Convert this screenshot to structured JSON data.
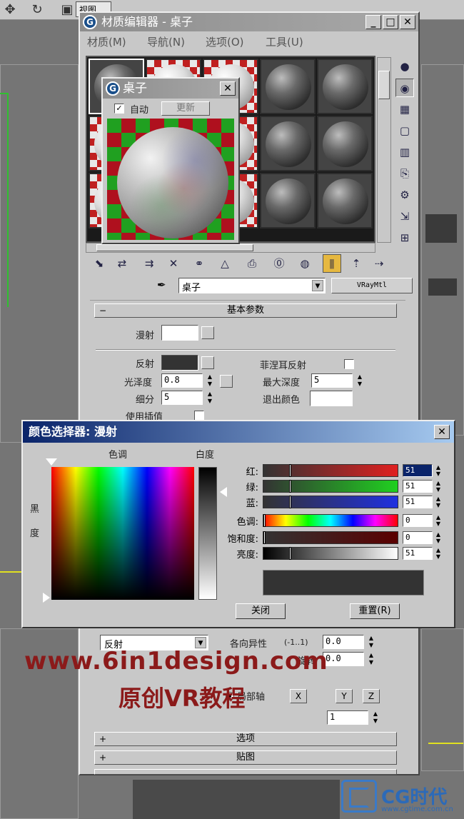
{
  "viewport": {
    "view_label": "视图"
  },
  "material_editor": {
    "title": "材质编辑器 - 桌子",
    "menu": [
      "材质(M)",
      "导航(N)",
      "选项(O)",
      "工具(U)"
    ],
    "material_name": "桌子",
    "material_type": "VRayMtl",
    "rollouts": {
      "basic_params": "基本参数",
      "options": "选项",
      "maps": "贴图"
    },
    "params": {
      "diffuse_label": "漫射",
      "reflect_label": "反射",
      "fresnel_label": "菲涅耳反射",
      "gloss_label": "光泽度",
      "gloss_value": "0.8",
      "max_depth_label": "最大深度",
      "max_depth_value": "5",
      "subdiv_label": "细分",
      "subdiv_value": "5",
      "exit_color_label": "退出颜色",
      "interp_label": "使用插值"
    },
    "lower": {
      "brdf_type": "反射",
      "aniso_label": "各向异性",
      "aniso_range": "(-1..1)",
      "aniso_value": "0.0",
      "rotation_label": "旋转",
      "rotation_value": "0.0",
      "local_axis_label": "局部轴",
      "axis_x": "X",
      "axis_y": "Y",
      "axis_z": "Z",
      "map_channel_value": "1"
    }
  },
  "preview": {
    "title": "桌子",
    "auto_label": "自动",
    "update_label": "更新"
  },
  "color_selector": {
    "title": "颜色选择器: 漫射",
    "hue_label": "色调",
    "whiteness_label": "白度",
    "blackness_label_1": "黑",
    "blackness_label_2": "度",
    "rows": [
      {
        "label": "红:",
        "value": "51"
      },
      {
        "label": "绿:",
        "value": "51"
      },
      {
        "label": "蓝:",
        "value": "51"
      },
      {
        "label": "色调:",
        "value": "0"
      },
      {
        "label": "饱和度:",
        "value": "0"
      },
      {
        "label": "亮度:",
        "value": "51"
      }
    ],
    "close_label": "关闭",
    "reset_label": "重置(R)",
    "current_color": "#333333"
  },
  "watermark": {
    "url": "www.6in1design.com",
    "subtitle": "原创VR教程",
    "logo_text": "CG时代",
    "logo_url": "www.cgtime.com.cn"
  }
}
